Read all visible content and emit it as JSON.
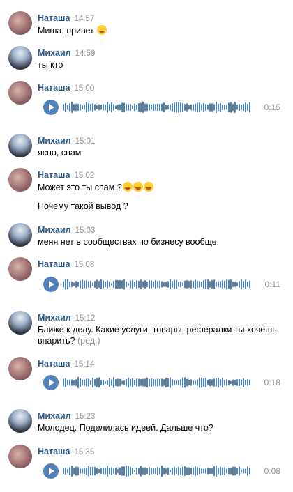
{
  "messages": [
    {
      "author": "Наташа",
      "time": "14:57",
      "lines": [
        "Миша, привет"
      ],
      "emoji": 1
    },
    {
      "author": "Михаил",
      "time": "14:59",
      "lines": [
        "ты кто"
      ]
    },
    {
      "author": "Наташа",
      "time": "15:00",
      "audio": {
        "duration": "0:15"
      }
    },
    {
      "author": "Михаил",
      "time": "15:01",
      "lines": [
        "ясно, спам"
      ]
    },
    {
      "author": "Наташа",
      "time": "15:02",
      "lines": [
        "Может это ты спам ?",
        "Почему такой вывод ?"
      ],
      "emoji_line0": 3
    },
    {
      "author": "Михаил",
      "time": "15:03",
      "lines": [
        "меня нет в сообществах по бизнесу вообще"
      ]
    },
    {
      "author": "Наташа",
      "time": "15:08",
      "audio": {
        "duration": "0:11"
      }
    },
    {
      "author": "Михаил",
      "time": "15:12",
      "lines": [
        "Ближе к делу. Какие услуги, товары, рефералки ты хочешь",
        "впарить?"
      ],
      "edited_label": "(ред.)"
    },
    {
      "author": "Наташа",
      "time": "15:14",
      "audio": {
        "duration": "0:18"
      }
    },
    {
      "author": "Михаил",
      "time": "15:23",
      "lines": [
        "Молодец. Поделилась идеей. Дальше что?"
      ]
    },
    {
      "author": "Наташа",
      "time": "15:35",
      "audio": {
        "duration": "0:08"
      }
    }
  ],
  "colors": {
    "author": "#2a5885",
    "time": "#939393",
    "play": "#5181b8",
    "wave": "#5181b8"
  }
}
